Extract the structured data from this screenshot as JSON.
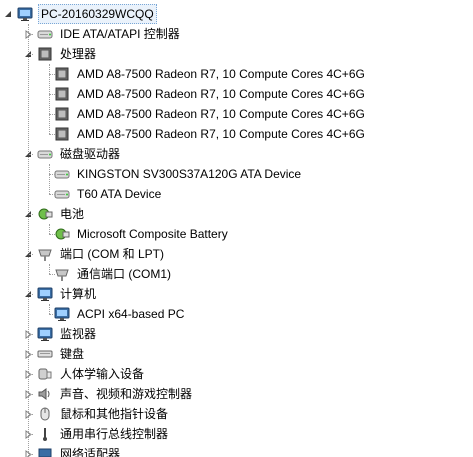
{
  "root": {
    "label": "PC-20160329WCQQ",
    "icon": "computer-root-icon"
  },
  "categories": [
    {
      "label": "IDE ATA/ATAPI 控制器",
      "icon": "ide-controller-icon",
      "expanded": false
    },
    {
      "label": "处理器",
      "icon": "processor-icon",
      "expanded": true,
      "children": [
        {
          "label": "AMD A8-7500 Radeon R7, 10 Compute Cores 4C+6G",
          "icon": "cpu-icon"
        },
        {
          "label": "AMD A8-7500 Radeon R7, 10 Compute Cores 4C+6G",
          "icon": "cpu-icon"
        },
        {
          "label": "AMD A8-7500 Radeon R7, 10 Compute Cores 4C+6G",
          "icon": "cpu-icon"
        },
        {
          "label": "AMD A8-7500 Radeon R7, 10 Compute Cores 4C+6G",
          "icon": "cpu-icon"
        }
      ]
    },
    {
      "label": "磁盘驱动器",
      "icon": "disk-drive-icon",
      "expanded": true,
      "children": [
        {
          "label": "KINGSTON SV300S37A120G ATA Device",
          "icon": "hard-disk-icon"
        },
        {
          "label": "T60 ATA Device",
          "icon": "hard-disk-icon"
        }
      ]
    },
    {
      "label": "电池",
      "icon": "battery-icon",
      "expanded": true,
      "children": [
        {
          "label": "Microsoft Composite Battery",
          "icon": "battery-device-icon"
        }
      ]
    },
    {
      "label": "端口 (COM 和 LPT)",
      "icon": "port-icon",
      "expanded": true,
      "children": [
        {
          "label": "通信端口 (COM1)",
          "icon": "com-port-icon"
        }
      ]
    },
    {
      "label": "计算机",
      "icon": "computer-icon",
      "expanded": true,
      "children": [
        {
          "label": "ACPI x64-based PC",
          "icon": "acpi-pc-icon"
        }
      ]
    },
    {
      "label": "监视器",
      "icon": "monitor-icon",
      "expanded": false
    },
    {
      "label": "键盘",
      "icon": "keyboard-icon",
      "expanded": false
    },
    {
      "label": "人体学输入设备",
      "icon": "hid-icon",
      "expanded": false
    },
    {
      "label": "声音、视频和游戏控制器",
      "icon": "sound-icon",
      "expanded": false
    },
    {
      "label": "鼠标和其他指针设备",
      "icon": "mouse-icon",
      "expanded": false
    },
    {
      "label": "通用串行总线控制器",
      "icon": "usb-icon",
      "expanded": false
    },
    {
      "label": "网络适配器",
      "icon": "network-adapter-icon",
      "expanded": false
    }
  ]
}
